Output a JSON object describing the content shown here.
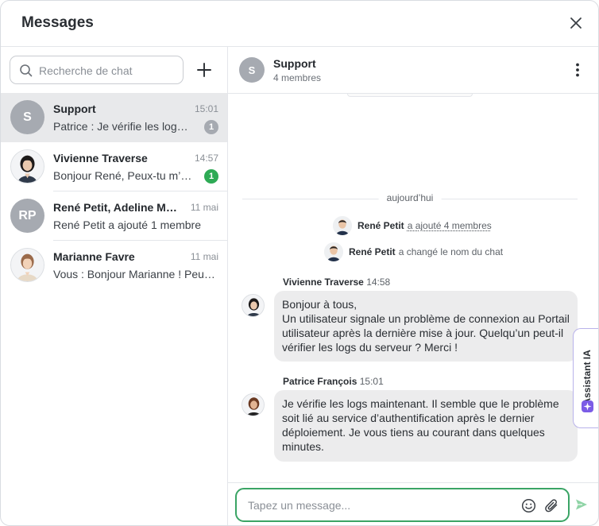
{
  "window": {
    "title": "Messages"
  },
  "sidebar": {
    "search_placeholder": "Recherche de chat",
    "chats": [
      {
        "avatar_initials": "S",
        "name": "Support",
        "time": "15:01",
        "preview": "Patrice : Je vérifie les logs maintenant.",
        "unread": "1",
        "badge_color": "#a6aab1",
        "active": true
      },
      {
        "avatar_initials": "",
        "name": "Vivienne Traverse",
        "time": "14:57",
        "preview": "Bonjour René, Peux-tu m’envoyer le rapport ?",
        "unread": "1",
        "badge_color": "#2eaa55",
        "active": false
      },
      {
        "avatar_initials": "RP",
        "name": "René Petit, Adeline Moreau",
        "time": "11 mai",
        "preview": "René Petit a ajouté 1 membre",
        "unread": "",
        "active": false
      },
      {
        "avatar_initials": "",
        "name": "Marianne Favre",
        "time": "11 mai",
        "preview": "Vous : Bonjour Marianne ! Peux-tu vérifier ?",
        "unread": "",
        "active": false
      }
    ]
  },
  "conversation": {
    "avatar_initials": "S",
    "name": "Support",
    "members": "4 membres",
    "day_separator": "aujourd’hui",
    "system_events": [
      {
        "actor": "René Petit",
        "action": "a ajouté 4 membres"
      },
      {
        "actor": "René Petit",
        "action": "a changé le nom du chat"
      }
    ],
    "messages": [
      {
        "author": "Vivienne Traverse",
        "time": "14:58",
        "text": "Bonjour à tous,\nUn utilisateur signale un problème de connexion au Portail utilisateur après la dernière mise à jour. Quelqu’un peut-il vérifier les logs du serveur ? Merci !"
      },
      {
        "author": "Patrice François",
        "time": "15:01",
        "text": "Je vérifie les logs maintenant. Il semble que le problème soit lié au service d’authentification après le dernier déploiement. Je vous tiens au courant dans quelques minutes."
      }
    ],
    "composer_placeholder": "Tapez un message..."
  },
  "ai_assistant": {
    "label": "Assistant IA"
  },
  "colors": {
    "accent_green": "#3aa465",
    "unread_green": "#2eaa55",
    "ai_purple": "#7b5ce6",
    "avatar_grey": "#a6aab1"
  },
  "icons": [
    "close-icon",
    "search-icon",
    "plus-icon",
    "kebab-menu-icon",
    "emoji-icon",
    "paperclip-icon",
    "send-icon",
    "sparkle-icon"
  ]
}
